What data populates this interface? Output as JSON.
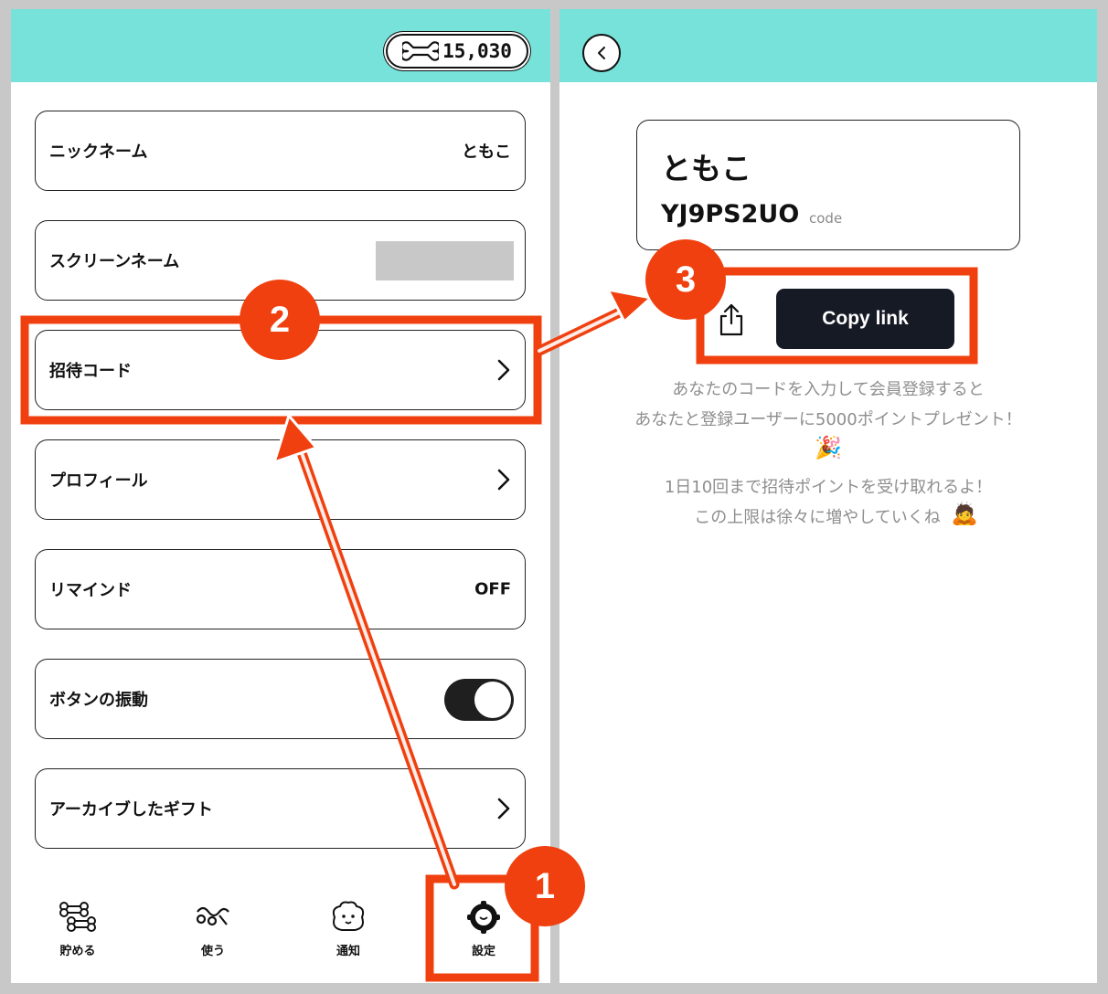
{
  "left": {
    "points": "15,030",
    "rows": [
      {
        "label": "ニックネーム",
        "value": "ともこ"
      },
      {
        "label": "スクリーンネーム"
      },
      {
        "label": "招待コード"
      },
      {
        "label": "プロフィール"
      },
      {
        "label": "リマインド",
        "value": "OFF"
      },
      {
        "label": "ボタンの振動",
        "toggle": "on"
      },
      {
        "label": "アーカイブしたギフト"
      }
    ],
    "tabs": [
      "貯める",
      "使う",
      "通知",
      "設定"
    ]
  },
  "right": {
    "name": "ともこ",
    "code": "YJ9PS2UO",
    "code_label": "code",
    "copy_label": "Copy link",
    "message": [
      "あなたのコードを入力して会員登録すると",
      "あなたと登録ユーザーに5000ポイントプレゼント！",
      "1日10回まで招待ポイントを受け取れるよ！",
      "この上限は徐々に増やしていくね"
    ],
    "emojis": [
      "🎉",
      "🙇"
    ]
  },
  "annotations": {
    "badges": [
      "1",
      "2",
      "3"
    ],
    "color": "#f0400f"
  },
  "colors": {
    "header": "#76e2da",
    "button_dark": "#151a24",
    "annotation_red": "#f0400f"
  }
}
